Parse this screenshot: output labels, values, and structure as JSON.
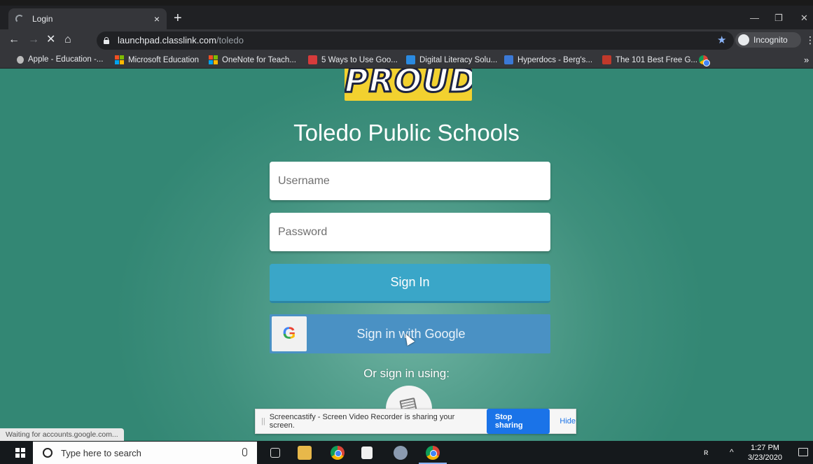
{
  "browser": {
    "tab_title": "Login",
    "tab_close": "×",
    "new_tab": "+",
    "url_domain": "launchpad.classlink.com",
    "url_path": "/toledo",
    "incognito_label": "Incognito",
    "bookmarks": [
      {
        "label": "Apple - Education -...",
        "icon": "apple-icon"
      },
      {
        "label": "Microsoft Education",
        "icon": "microsoft-icon"
      },
      {
        "label": "OneNote for Teach...",
        "icon": "microsoft-icon"
      },
      {
        "label": "5 Ways to Use Goo...",
        "icon": "red-favicon"
      },
      {
        "label": "Digital Literacy Solu...",
        "icon": "blue-l-favicon"
      },
      {
        "label": "Hyperdocs - Berg's...",
        "icon": "blue-favicon"
      },
      {
        "label": "The 101 Best Free G...",
        "icon": "pc-favicon"
      }
    ],
    "status_text": "Waiting for accounts.google.com..."
  },
  "page": {
    "logo_text": "PROUD",
    "school_name": "Toledo Public Schools",
    "username_placeholder": "Username",
    "password_placeholder": "Password",
    "signin_label": "Sign In",
    "google_icon_letter": "G",
    "google_label": "Sign in with Google",
    "or_sign_in": "Or sign in using:",
    "colors": {
      "background": "#3e8f7c",
      "signin_button": "#3aa6c8",
      "google_button": "#4a91c4"
    }
  },
  "sharebar": {
    "message": "Screencastify - Screen Video Recorder is sharing your screen.",
    "stop_label": "Stop sharing",
    "hide_label": "Hide"
  },
  "taskbar": {
    "search_placeholder": "Type here to search",
    "time": "1:27 PM",
    "date": "3/23/2020"
  }
}
